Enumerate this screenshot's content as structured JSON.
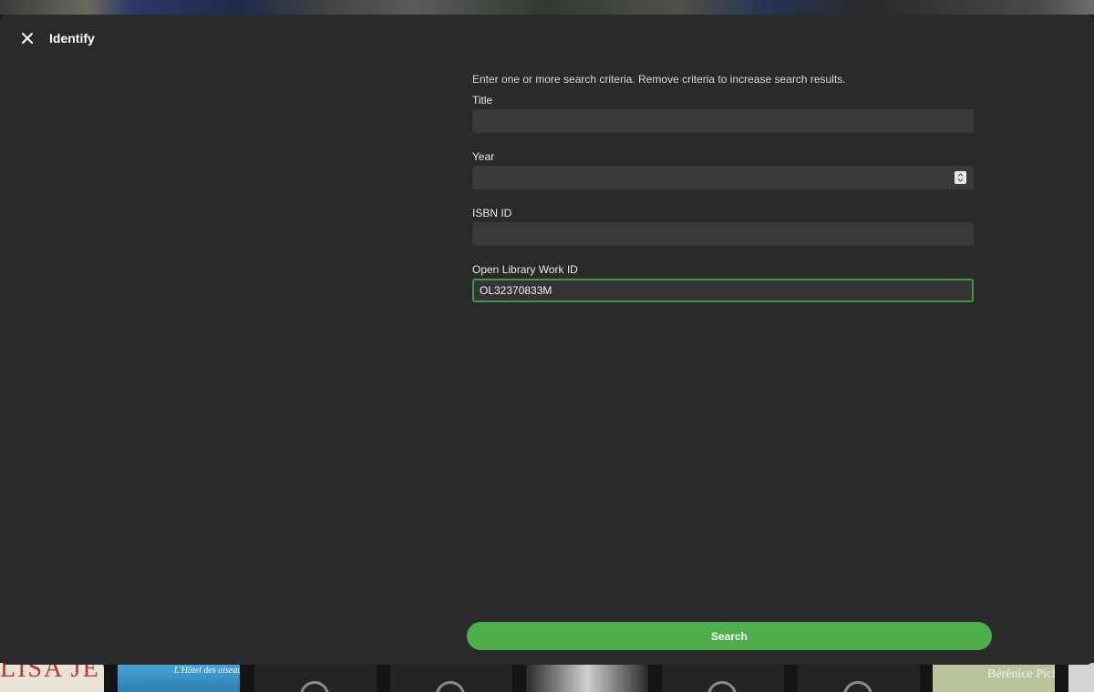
{
  "dialog": {
    "title": "Identify",
    "close_icon": "close-icon"
  },
  "form": {
    "hint": "Enter one or more search criteria. Remove criteria to increase search results.",
    "fields": [
      {
        "label": "Title",
        "value": ""
      },
      {
        "label": "Year",
        "value": ""
      },
      {
        "label": "ISBN ID",
        "value": ""
      },
      {
        "label": "Open Library Work ID",
        "value": "OL32370833M"
      }
    ],
    "search_label": "Search"
  },
  "background_covers": [
    {
      "text": "LISA JEWELL"
    },
    {
      "text": "L'Hôtel des oiseaux"
    },
    {
      "text": "Bérénice Pichat"
    }
  ],
  "colors": {
    "accent": "#4caf4a",
    "dialog_bg": "#2a2a2c",
    "input_bg": "#3a3a3d",
    "focus_border": "#3f9a3f"
  }
}
